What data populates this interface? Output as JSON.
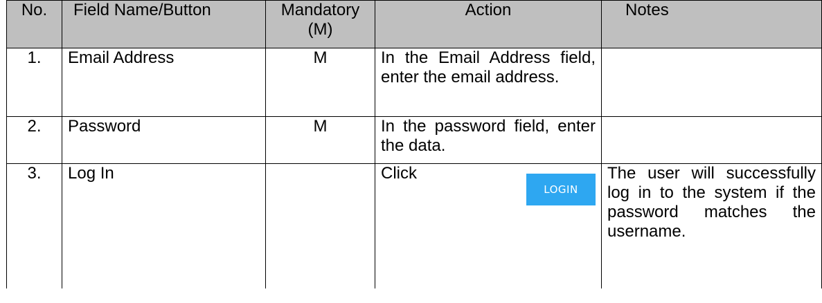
{
  "table": {
    "headers": {
      "no": "No.",
      "field": "Field Name/Button",
      "mandatory": "Mandatory (M)",
      "action": "Action",
      "notes": "Notes"
    },
    "rows": [
      {
        "no": "1.",
        "field": "Email Address",
        "mandatory": "M",
        "action": "In the Email Address field, enter the email address.",
        "notes": ""
      },
      {
        "no": "2.",
        "field": "Password",
        "mandatory": "M",
        "action": "In the password field, enter the data.",
        "notes": ""
      },
      {
        "no": "3.",
        "field": "Log In",
        "mandatory": "",
        "action": "Click",
        "button_label": "LOGIN",
        "notes": "The user will successfully log in to the system if the password matches the username."
      }
    ]
  },
  "colors": {
    "header_bg": "#bfbfbf",
    "button_bg": "#2ea7f1",
    "button_text": "#ffffff"
  }
}
